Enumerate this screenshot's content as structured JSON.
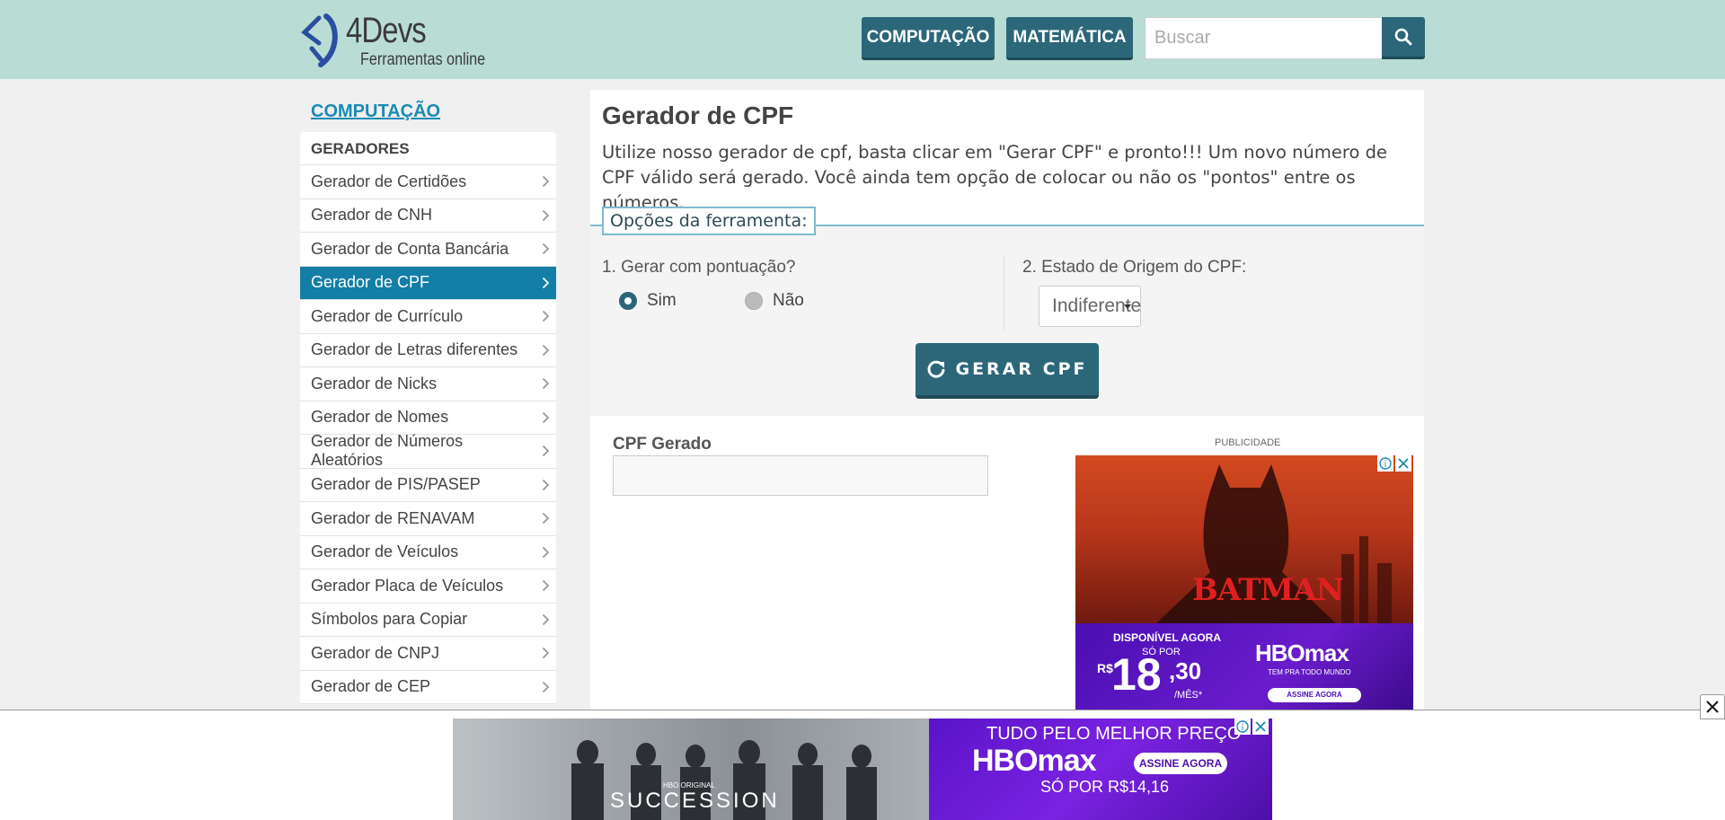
{
  "header": {
    "logo_title": "4Devs",
    "logo_subtitle": "Ferramentas online",
    "nav": [
      {
        "label": "COMPUTAÇÃO"
      },
      {
        "label": "MATEMÁTICA"
      }
    ],
    "search_placeholder": "Buscar",
    "search_icon": "search-icon"
  },
  "sidebar": {
    "category": "COMPUTAÇÃO",
    "section": "GERADORES",
    "items": [
      {
        "label": "Gerador de Certidões",
        "active": false
      },
      {
        "label": "Gerador de CNH",
        "active": false
      },
      {
        "label": "Gerador de Conta Bancária",
        "active": false
      },
      {
        "label": "Gerador de CPF",
        "active": true
      },
      {
        "label": "Gerador de Currículo",
        "active": false
      },
      {
        "label": "Gerador de Letras diferentes",
        "active": false
      },
      {
        "label": "Gerador de Nicks",
        "active": false
      },
      {
        "label": "Gerador de Nomes",
        "active": false
      },
      {
        "label": "Gerador de Números Aleatórios",
        "active": false
      },
      {
        "label": "Gerador de PIS/PASEP",
        "active": false
      },
      {
        "label": "Gerador de RENAVAM",
        "active": false
      },
      {
        "label": "Gerador de Veículos",
        "active": false
      },
      {
        "label": "Gerador Placa de Veículos",
        "active": false
      },
      {
        "label": "Símbolos para Copiar",
        "active": false
      },
      {
        "label": "Gerador de CNPJ",
        "active": false
      },
      {
        "label": "Gerador de CEP",
        "active": false
      }
    ]
  },
  "main": {
    "title": "Gerador de CPF",
    "description": "Utilize nosso gerador de cpf, basta clicar em \"Gerar CPF\" e pronto!!! Um novo número de CPF válido será gerado. Você ainda tem opção de colocar ou não os \"pontos\" entre os números.",
    "options_legend": "Opções da ferramenta:",
    "option1_label": "1. Gerar com pontuação?",
    "option1_yes": "Sim",
    "option1_no": "Não",
    "option1_selected": "Sim",
    "option2_label": "2. Estado de Origem do CPF:",
    "option2_value": "Indiferente",
    "generate_label": "GERAR CPF",
    "result_label": "CPF Gerado",
    "result_value": ""
  },
  "ads": {
    "label": "PUBLICIDADE",
    "side": {
      "title": "BATMAN",
      "available": "DISPONÍVEL AGORA",
      "price_prefix": "SÓ POR",
      "currency": "R$",
      "price_int": "18",
      "price_dec": ",30",
      "per": "/MÊS*",
      "brand": "HBOmax",
      "tagline": "TEM PRA TODO MUNDO",
      "cta": "ASSINE AGORA"
    },
    "bottom": {
      "show": "SUCCESSION",
      "show_badge": "HBO ORIGINAL",
      "headline": "TUDO PELO MELHOR PREÇO",
      "brand": "HBOmax",
      "cta": "ASSINE AGORA",
      "price": "SÓ POR R$14,16"
    }
  },
  "colors": {
    "header_bg": "#b9ddd4",
    "primary_button": "#2b6778",
    "sidebar_active": "#137ea6",
    "link": "#1a8bb3"
  }
}
